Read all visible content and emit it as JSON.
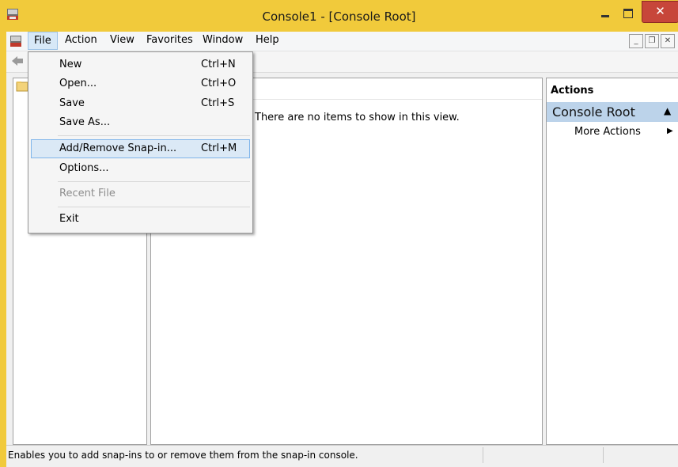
{
  "window": {
    "title": "Console1 - [Console Root]",
    "close_glyph": "✕",
    "accent": "#f1ca3b"
  },
  "menubar": {
    "items": [
      "File",
      "Action",
      "View",
      "Favorites",
      "Window",
      "Help"
    ],
    "mdi_min": "_",
    "mdi_restore": "❐",
    "mdi_close": "✕"
  },
  "file_menu": {
    "items": [
      {
        "label": "New",
        "shortcut": "Ctrl+N"
      },
      {
        "label": "Open...",
        "shortcut": "Ctrl+O"
      },
      {
        "label": "Save",
        "shortcut": "Ctrl+S"
      },
      {
        "label": "Save As...",
        "shortcut": ""
      },
      {
        "label": "Add/Remove Snap-in...",
        "shortcut": "Ctrl+M"
      },
      {
        "label": "Options...",
        "shortcut": ""
      },
      {
        "label": "Recent File",
        "shortcut": ""
      },
      {
        "label": "Exit",
        "shortcut": ""
      }
    ]
  },
  "center": {
    "empty_message": "There are no items to show in this view."
  },
  "actions": {
    "title": "Actions",
    "section": "Console Root",
    "section_caret": "▲",
    "more": "More Actions",
    "more_caret": "▶"
  },
  "statusbar": {
    "text": "Enables you to add snap-ins to or remove them from the snap-in console."
  },
  "icons": [
    "mmc-app-icon",
    "back-arrow-icon",
    "folder-icon"
  ]
}
